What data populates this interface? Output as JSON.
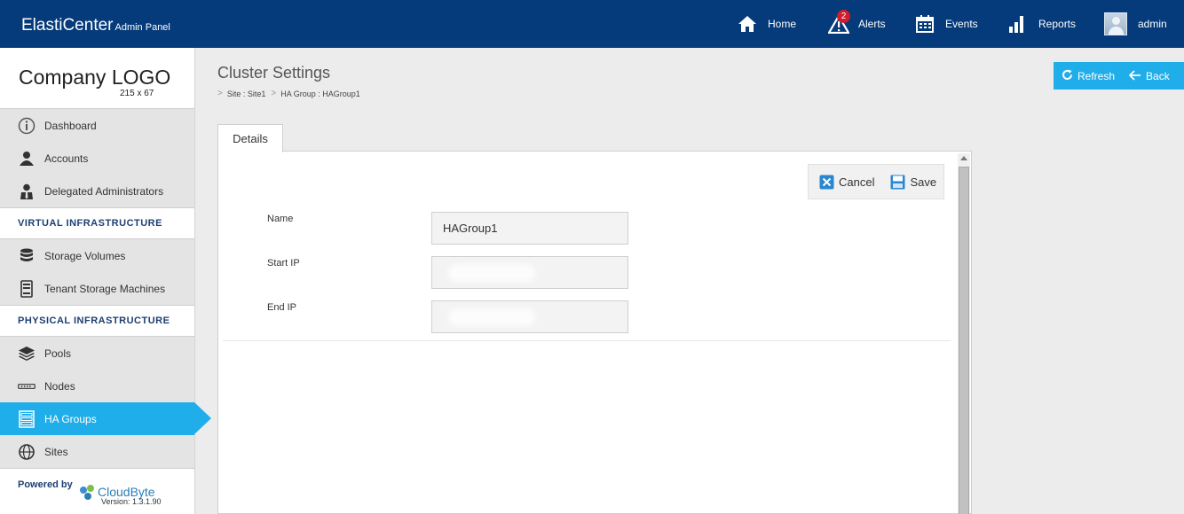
{
  "header": {
    "app_name": "ElastiCenter",
    "app_sub": "Admin Panel",
    "nav": {
      "home": "Home",
      "alerts": "Alerts",
      "alerts_count": "2",
      "events": "Events",
      "reports": "Reports",
      "user": "admin"
    }
  },
  "sidebar": {
    "logo_title": "Company LOGO",
    "logo_dims": "215 x 67",
    "items_top": [
      "Dashboard",
      "Accounts",
      "Delegated Administrators"
    ],
    "virtual_heading": "VIRTUAL INFRASTRUCTURE",
    "items_virtual": [
      "Storage Volumes",
      "Tenant Storage Machines"
    ],
    "physical_heading": "PHYSICAL INFRASTRUCTURE",
    "items_physical": [
      "Pools",
      "Nodes",
      "HA Groups",
      "Sites"
    ],
    "active_item": "HA Groups",
    "powered_by": "Powered by",
    "brand": "CloudByte",
    "version": "Version: 1.3.1.90"
  },
  "main": {
    "title": "Cluster Settings",
    "breadcrumbs": [
      "Site : Site1",
      "HA Group : HAGroup1"
    ],
    "refresh": "Refresh",
    "back": "Back",
    "tab": "Details",
    "cancel": "Cancel",
    "save": "Save",
    "fields": {
      "name_label": "Name",
      "name_value": "HAGroup1",
      "start_ip_label": "Start IP",
      "end_ip_label": "End IP"
    }
  },
  "colors": {
    "topbar": "#053b7a",
    "accent": "#1faee9",
    "badge": "#d01c2b"
  }
}
